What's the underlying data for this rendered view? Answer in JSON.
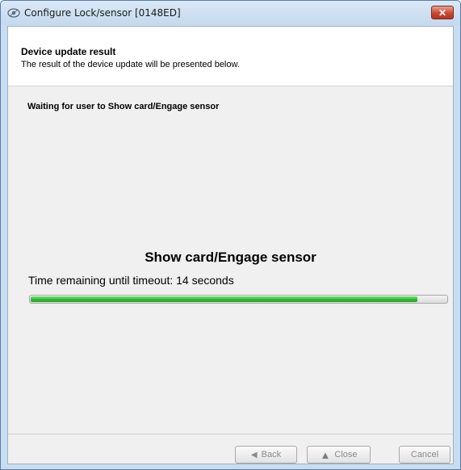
{
  "window": {
    "title": "Configure Lock/sensor [0148ED]",
    "app_icon": "lock-sensor-icon",
    "close_glyph": "✕"
  },
  "header": {
    "title": "Device update result",
    "subtitle": "The result of the device update will be presented below."
  },
  "status": {
    "text": "Waiting for user to Show card/Engage sensor"
  },
  "prompt": {
    "text": "Show card/Engage sensor"
  },
  "timeout": {
    "text": "Time remaining until timeout: 14 seconds",
    "progress_fraction": 0.93,
    "progress_color": "#2db52d"
  },
  "buttons": {
    "back": {
      "label": "Back",
      "icon": "◀"
    },
    "close": {
      "label": "Close",
      "icon": "▲"
    },
    "cancel": {
      "label": "Cancel"
    }
  }
}
